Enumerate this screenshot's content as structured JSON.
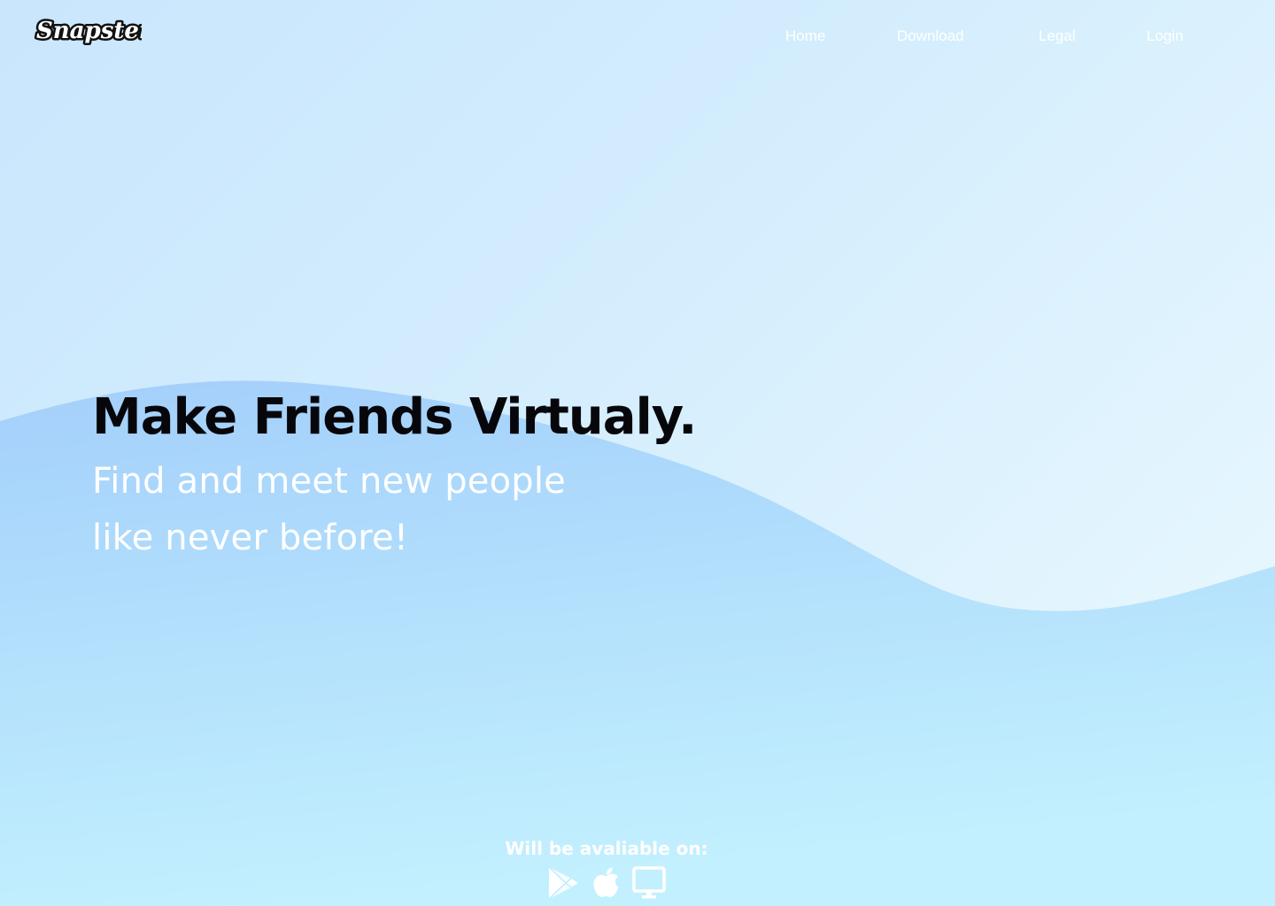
{
  "brand": {
    "logo_text": "Snapster"
  },
  "nav": {
    "items": [
      {
        "label": "Home"
      },
      {
        "label": "Download"
      },
      {
        "label": "Legal"
      },
      {
        "label": "Login"
      }
    ]
  },
  "hero": {
    "title": "Make Friends Virtualy.",
    "subtitle": "Find and meet new people like never before!"
  },
  "availability": {
    "label": "Will be avaliable on:",
    "platforms": [
      {
        "icon": "google-play-icon"
      },
      {
        "icon": "apple-icon"
      },
      {
        "icon": "desktop-monitor-icon"
      }
    ]
  },
  "colors": {
    "background_light": "#ecf9fe",
    "background_blue": "#c9e6fd",
    "wave": "#a7d4fb",
    "title_text": "#07070b",
    "light_text": "#ffffff"
  }
}
